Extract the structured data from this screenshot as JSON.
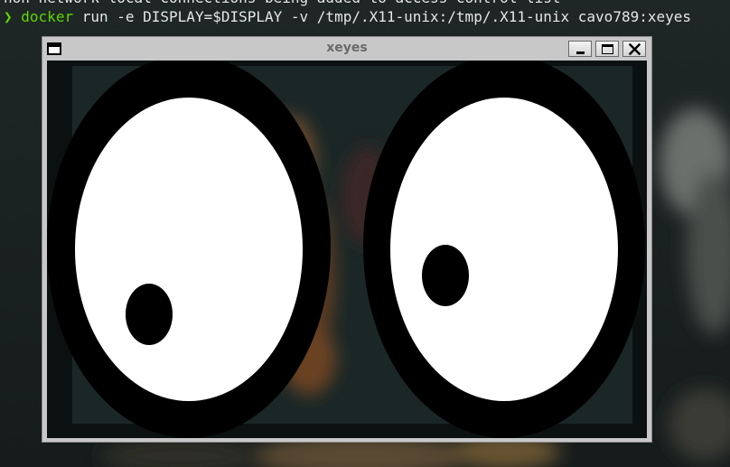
{
  "terminal": {
    "previous_line": "non-network local connections being added to access control list",
    "prompt_symbol": "❯",
    "command_name": "docker",
    "command_args": " run -e DISPLAY=$DISPLAY -v /tmp/.X11-unix:/tmp/.X11-unix cavo789:xeyes"
  },
  "window": {
    "title": "xeyes",
    "icons": {
      "menu": "window-menu-icon",
      "minimize": "minimize-icon",
      "maximize": "maximize-icon",
      "close": "close-icon"
    }
  },
  "colors": {
    "prompt_green": "#5fd700",
    "terminal_text": "#e6e6e6",
    "window_frame": "#c8c8c8",
    "title_text": "#6a6a6a",
    "eye_outline": "#000000",
    "eye_white": "#ffffff"
  }
}
